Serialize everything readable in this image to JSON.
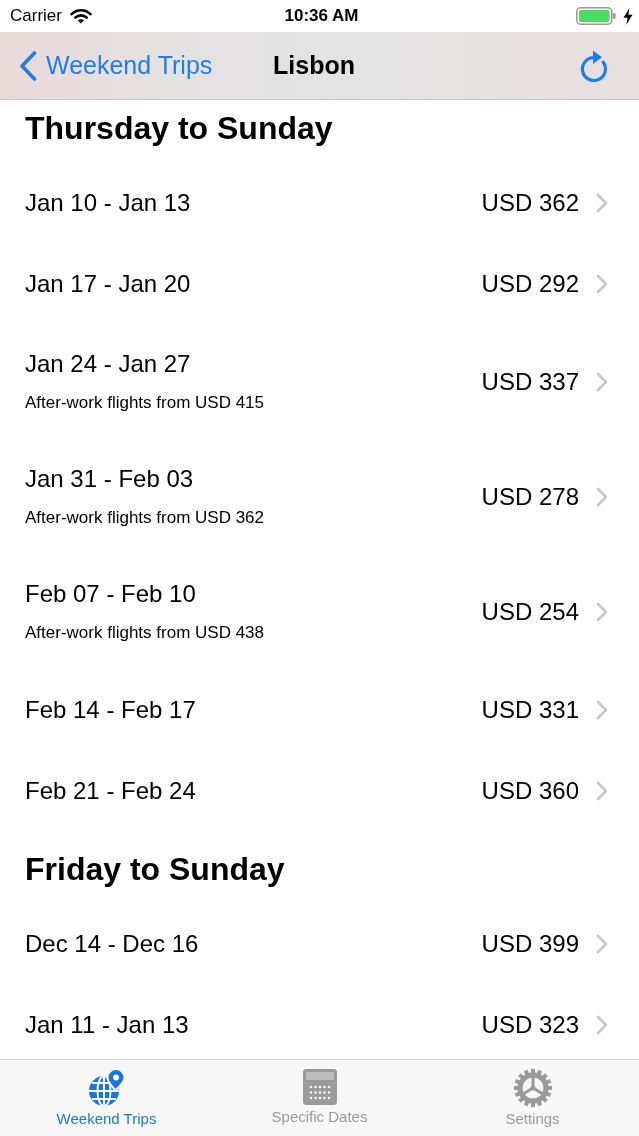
{
  "status_bar": {
    "carrier": "Carrier",
    "time": "10:36 AM"
  },
  "nav_bar": {
    "back_label": "Weekend Trips",
    "title": "Lisbon"
  },
  "sections": [
    {
      "title": "Thursday to Sunday",
      "rows": [
        {
          "dates": "Jan 10 - Jan 13",
          "price": "USD 362"
        },
        {
          "dates": "Jan 17 - Jan 20",
          "price": "USD 292"
        },
        {
          "dates": "Jan 24 - Jan 27",
          "note": "After-work flights from USD 415",
          "price": "USD 337"
        },
        {
          "dates": "Jan 31 - Feb 03",
          "note": "After-work flights from USD 362",
          "price": "USD 278"
        },
        {
          "dates": "Feb 07 - Feb 10",
          "note": "After-work flights from USD 438",
          "price": "USD 254"
        },
        {
          "dates": "Feb 14 - Feb 17",
          "price": "USD 331"
        },
        {
          "dates": "Feb 21 - Feb 24",
          "price": "USD 360"
        }
      ]
    },
    {
      "title": "Friday to Sunday",
      "rows": [
        {
          "dates": "Dec 14 - Dec 16",
          "price": "USD 399"
        },
        {
          "dates": "Jan 11 - Jan 13",
          "price": "USD 323"
        }
      ]
    }
  ],
  "tab_bar": [
    {
      "label": "Weekend Trips",
      "selected": true
    },
    {
      "label": "Specific Dates",
      "selected": false
    },
    {
      "label": "Settings",
      "selected": false
    }
  ]
}
